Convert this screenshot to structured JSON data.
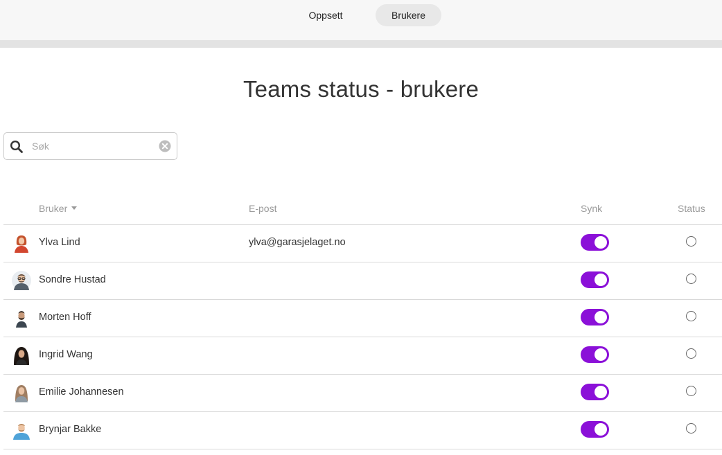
{
  "nav": {
    "tabs": [
      {
        "label": "Oppsett",
        "active": false
      },
      {
        "label": "Brukere",
        "active": true
      }
    ]
  },
  "page": {
    "title": "Teams status - brukere"
  },
  "search": {
    "placeholder": "Søk",
    "value": ""
  },
  "table": {
    "columns": {
      "user": "Bruker",
      "email": "E-post",
      "sync": "Synk",
      "status": "Status"
    },
    "rows": [
      {
        "name": "Ylva Lind",
        "email": "ylva@garasjelaget.no",
        "sync": true
      },
      {
        "name": "Sondre Hustad",
        "email": "",
        "sync": true
      },
      {
        "name": "Morten Hoff",
        "email": "",
        "sync": true
      },
      {
        "name": "Ingrid Wang",
        "email": "",
        "sync": true
      },
      {
        "name": "Emilie Johannesen",
        "email": "",
        "sync": true
      },
      {
        "name": "Brynjar Bakke",
        "email": "",
        "sync": true
      }
    ]
  },
  "colors": {
    "accent": "#8b10d8",
    "border": "#d9d9d9",
    "header_text": "#9a9a9a"
  }
}
